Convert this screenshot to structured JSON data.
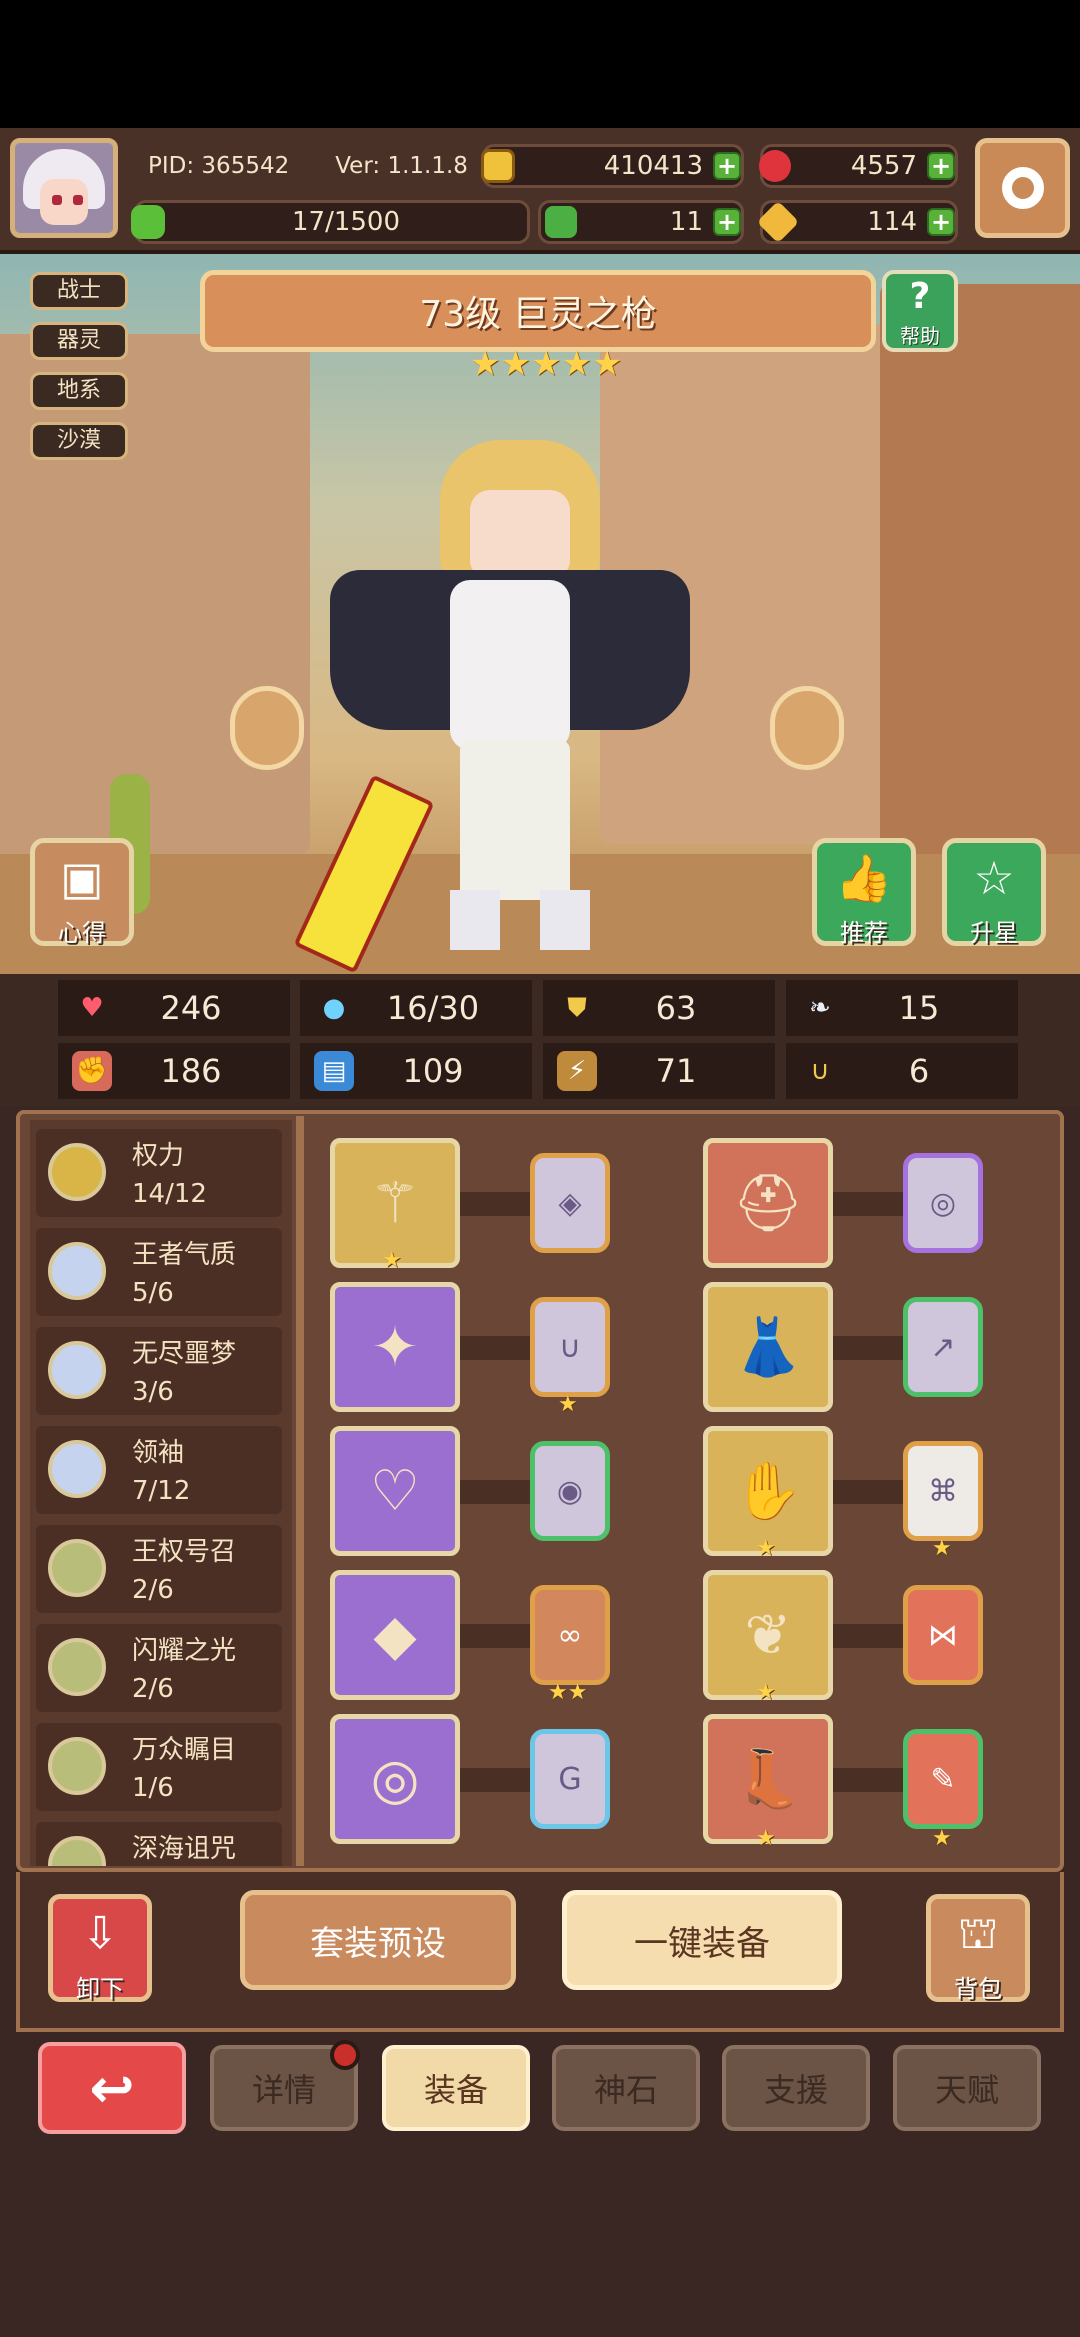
{
  "player": {
    "pid": "PID: 365542",
    "version": "Ver: 1.1.1.8",
    "gold": "410413",
    "gems": "4557",
    "stamina": "17/1500",
    "clover": "11",
    "key": "114"
  },
  "tags": [
    "战士",
    "器灵",
    "地系",
    "沙漠"
  ],
  "hero": {
    "title": "73级  巨灵之枪",
    "stars": "★★★★★",
    "help_label": "帮助",
    "tips_label": "心得",
    "recommend_label": "推荐",
    "upstar_label": "升星"
  },
  "stats": {
    "hp": "246",
    "mana": "16/30",
    "defense": "63",
    "speed": "15",
    "attack": "186",
    "magic": "109",
    "crit": "71",
    "luck": "6"
  },
  "sets": [
    {
      "name": "权力",
      "count": "14/12",
      "color": "#d9b446"
    },
    {
      "name": "王者气质",
      "count": "5/6",
      "color": "#c6d3ee"
    },
    {
      "name": "无尽噩梦",
      "count": "3/6",
      "color": "#c6d3ee"
    },
    {
      "name": "领袖",
      "count": "7/12",
      "color": "#c6d3ee"
    },
    {
      "name": "王权号召",
      "count": "2/6",
      "color": "#b9bd7a"
    },
    {
      "name": "闪耀之光",
      "count": "2/6",
      "color": "#b9bd7a"
    },
    {
      "name": "万众瞩目",
      "count": "1/6",
      "color": "#b9bd7a"
    },
    {
      "name": "深海诅咒",
      "count": "",
      "color": "#b9bd7a"
    }
  ],
  "actions": {
    "unequip": "卸下",
    "preset": "套装预设",
    "equip_all": "一键装备",
    "bag": "背包"
  },
  "tabs": {
    "details": "详情",
    "equip": "装备",
    "stone": "神石",
    "support": "支援",
    "talent": "天赋"
  },
  "colors": {
    "gold_slot": "#d9b35a",
    "purple_slot": "#9a6fd0",
    "red_slot": "#d1735a"
  }
}
